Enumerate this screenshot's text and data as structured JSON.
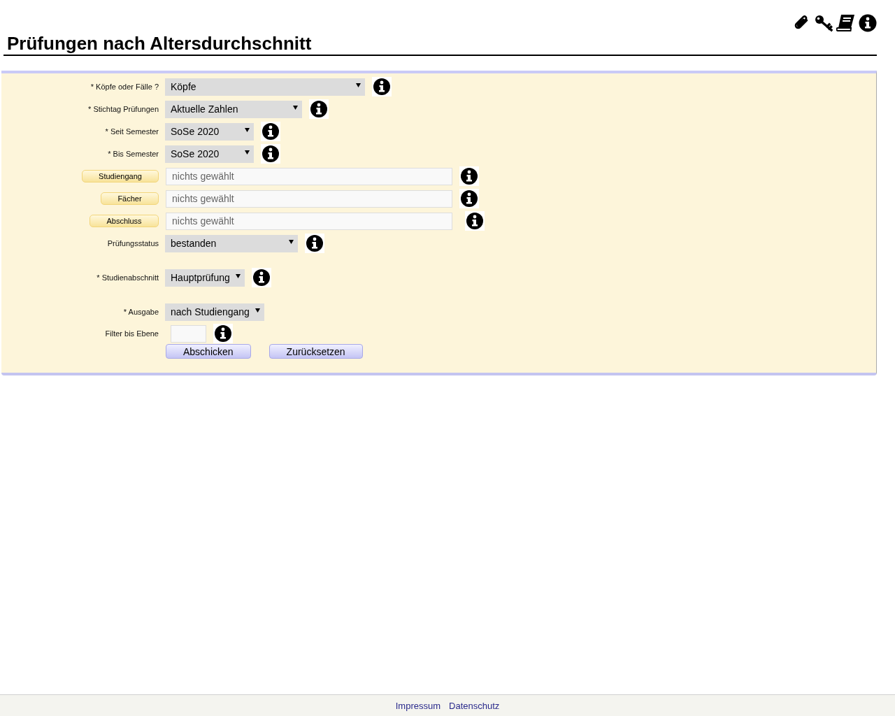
{
  "page": {
    "title": "Prüfungen nach Altersdurchschnitt"
  },
  "filters": [
    {
      "kind": "select",
      "label": "* Köpfe oder Fälle ?",
      "value": "Köpfe",
      "help": true
    },
    {
      "kind": "select",
      "label": "* Stichtag Prüfungen",
      "value": "Aktuelle Zahlen",
      "help": true
    },
    {
      "kind": "select",
      "label": "* Seit Semester",
      "value": "SoSe 2020",
      "help": true
    },
    {
      "kind": "select",
      "label": "* Bis Semester",
      "value": "SoSe 2020",
      "help": true
    },
    {
      "kind": "picker",
      "label": "Studiengang",
      "placeholder": "nichts gewählt",
      "help": true
    },
    {
      "kind": "picker",
      "label": "Fächer",
      "placeholder": "nichts gewählt",
      "help": true
    },
    {
      "kind": "picker",
      "label": "Abschluss",
      "placeholder": "nichts gewählt",
      "help": true
    },
    {
      "kind": "select",
      "label": "Prüfungsstatus",
      "value": "bestanden",
      "help": true
    }
  ],
  "section_filters": [
    {
      "kind": "select",
      "label": "* Studienabschnitt",
      "value": "Hauptprüfung",
      "help": true
    }
  ],
  "output_filters": [
    {
      "kind": "select",
      "label": "* Ausgabe",
      "value": "nach Studiengang",
      "help": false
    },
    {
      "kind": "text",
      "label": "Filter bis Ebene",
      "help": true
    }
  ],
  "buttons": [
    "Abschicken",
    "Zurücksetzen"
  ],
  "footer": {
    "links": [
      "Impressum",
      "Datenschutz"
    ]
  }
}
